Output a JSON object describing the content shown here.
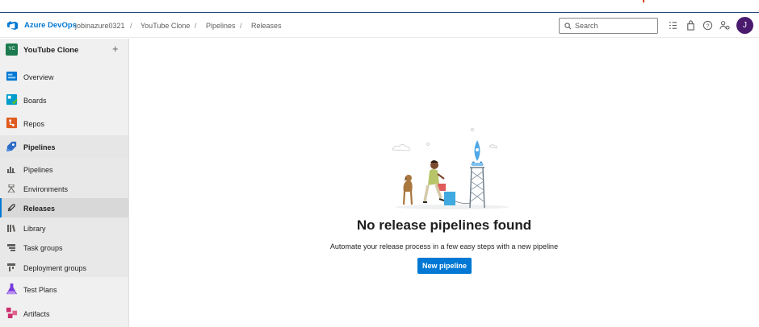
{
  "header": {
    "brand": "Azure DevOps",
    "org": "jobinazure0321",
    "breadcrumbs": [
      "YouTube Clone",
      "Pipelines",
      "Releases"
    ],
    "search_placeholder": "Search",
    "icons": [
      "task-list-icon",
      "shopping-bag-icon",
      "help-icon",
      "user-settings-icon"
    ],
    "avatar_initial": "J"
  },
  "sidebar": {
    "project_badge": "YC",
    "project_name": "YouTube Clone",
    "add_symbol": "+",
    "items": [
      {
        "label": "Overview",
        "icon": "overview-icon",
        "color": "#0078d4"
      },
      {
        "label": "Boards",
        "icon": "boards-icon",
        "color": "#009ccc"
      },
      {
        "label": "Repos",
        "icon": "repos-icon",
        "color": "#e05b1f"
      },
      {
        "label": "Pipelines",
        "icon": "pipelines-icon",
        "color": "#2f6cc9"
      }
    ],
    "sub_items": [
      {
        "label": "Pipelines",
        "icon": "pipelines-sub-icon"
      },
      {
        "label": "Environments",
        "icon": "environments-icon"
      },
      {
        "label": "Releases",
        "icon": "releases-icon",
        "active": true
      },
      {
        "label": "Library",
        "icon": "library-icon"
      },
      {
        "label": "Task groups",
        "icon": "task-groups-icon"
      },
      {
        "label": "Deployment groups",
        "icon": "deployment-groups-icon"
      }
    ],
    "bottom_items": [
      {
        "label": "Test Plans",
        "icon": "test-plans-icon",
        "color": "#773adc"
      },
      {
        "label": "Artifacts",
        "icon": "artifacts-icon",
        "color": "#cb2e6d"
      }
    ]
  },
  "main": {
    "title": "No release pipelines found",
    "description": "Automate your release process in a few easy steps with a new pipeline",
    "button_label": "New pipeline"
  },
  "colors": {
    "accent": "#0078d4",
    "avatar": "#4a1a6e",
    "project_badge": "#1b7a4e"
  }
}
